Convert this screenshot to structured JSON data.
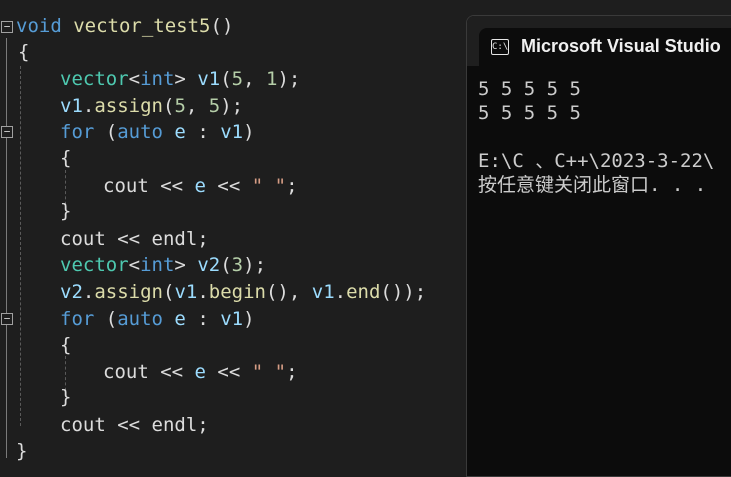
{
  "editor": {
    "code": {
      "sig_kw": "void",
      "sig_name": "vector_test5",
      "sig_parens": "()",
      "brace_open": "{",
      "brace_close": "}",
      "l1_type": "vector",
      "l1_lt": "<",
      "l1_int": "int",
      "l1_gt": ">",
      "l1_var": "v1",
      "l1_p1": "(",
      "l1_n1": "5",
      "l1_comma": ", ",
      "l1_n2": "1",
      "l1_p2": ");",
      "l2_var": "v1",
      "l2_dot": ".",
      "l2_fn": "assign",
      "l2_p1": "(",
      "l2_n1": "5",
      "l2_comma": ", ",
      "l2_n2": "5",
      "l2_p2": ");",
      "for_kw": "for",
      "for_p1": " (",
      "auto_kw": "auto",
      "for_e": " e",
      "for_colon": " : ",
      "for_v1": "v1",
      "for_p2": ")",
      "inner_open": "{",
      "inner_close": "}",
      "cout": "cout",
      "shl": " << ",
      "e": "e",
      "space_str": "\" \"",
      "semi": ";",
      "endl": "endl",
      "l6_type": "vector",
      "l6_lt": "<",
      "l6_int": "int",
      "l6_gt": ">",
      "l6_var": "v2",
      "l6_p1": "(",
      "l6_n1": "3",
      "l6_p2": ");",
      "l7_v2": "v2",
      "l7_dot": ".",
      "l7_fn": "assign",
      "l7_p1": "(",
      "l7_v1a": "v1",
      "l7_dot2": ".",
      "l7_begin": "begin",
      "l7_mid": "(), ",
      "l7_v1b": "v1",
      "l7_dot3": ".",
      "l7_end": "end",
      "l7_p2": "());",
      "fold_minus": "−"
    }
  },
  "console": {
    "icon": "C:\\",
    "title": "Microsoft Visual Studio",
    "lines": [
      "5 5 5 5 5",
      "5 5 5 5 5",
      "",
      "E:\\C 、C++\\2023-3-22\\",
      "按任意键关闭此窗口. . ."
    ]
  },
  "colors": {
    "editor_bg": "#1e1e1e",
    "keyword": "#569cd6",
    "type": "#4ec9b0",
    "function": "#dcdcaa",
    "variable": "#9cdcfe",
    "number": "#b5cea8",
    "string": "#d69d85",
    "console_bg": "#0c0c0c"
  }
}
